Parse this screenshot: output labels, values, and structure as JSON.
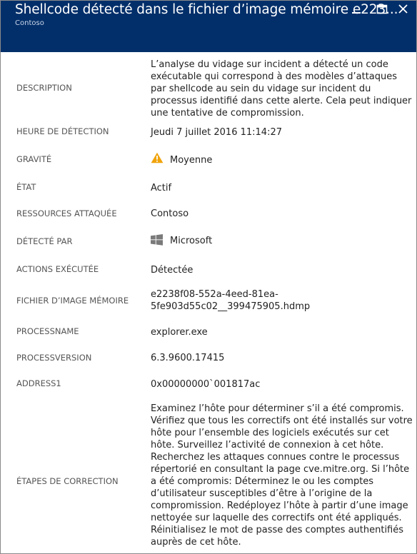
{
  "window": {
    "title": "Shellcode détecté dans le fichier d’image mémoire e223...",
    "subtitle": "Contoso",
    "controls": {
      "minimize": "minimize",
      "maximize": "maximize",
      "close": "close"
    }
  },
  "fields": {
    "description": {
      "label": "DESCRIPTION",
      "value": "L’analyse du vidage sur incident a détecté un code exécutable qui correspond à des modèles d’attaques par shellcode au sein du vidage sur incident du processus identifié dans cette alerte. Cela peut indiquer une tentative de compromission."
    },
    "detection_time": {
      "label": "HEURE DE DÉTECTION",
      "value": "Jeudi 7 juillet 2016 11:14:27"
    },
    "severity": {
      "label": "GRAVITÉ",
      "value": "Moyenne",
      "icon": "warning-icon",
      "icon_color": "#f0a30a"
    },
    "state": {
      "label": "ÉTAT",
      "value": "Actif"
    },
    "attacked_resources": {
      "label": "RESSOURCES ATTAQUÉE",
      "value": "Contoso"
    },
    "detected_by": {
      "label": "DÉTECTÉ PAR",
      "value": "Microsoft",
      "icon": "windows-logo-icon"
    },
    "actions_taken": {
      "label": "ACTIONS EXÉCUTÉE",
      "value": "Détectée"
    },
    "dump_file": {
      "label": "FICHIER D’IMAGE MÉMOIRE",
      "value_line1": "e2238f08-552a-4eed-81ea-",
      "value_line2": "5fe903d55c02__399475905.hdmp"
    },
    "process_name": {
      "label": "PROCESSNAME",
      "value": "explorer.exe"
    },
    "process_version": {
      "label": "PROCESSVERSION",
      "value": "6.3.9600.17415"
    },
    "address1": {
      "label": "ADDRESS1",
      "value": "0x00000000`001817ac"
    },
    "remediation": {
      "label": "ÉTAPES DE CORRECTION",
      "value": "Examinez l’hôte pour déterminer s’il a été compromis. Vérifiez que tous les correctifs ont été installés sur votre hôte pour l’ensemble des logiciels exécutés sur cet hôte. Surveillez l’activité de connexion à cet hôte. Recherchez les attaques connues contre le processus répertorié en consultant la page cve.mitre.org. Si l’hôte a été compromis: Déterminez le ou les comptes d’utilisateur susceptibles d’être à l’origine de la compromission. Redéployez l’hôte à partir d’une image nettoyée sur laquelle des correctifs ont été appliqués. Réinitialisez le mot de passe des comptes authentifiés auprès de cet hôte."
    }
  },
  "colors": {
    "header_bg": "#022f6a",
    "warning": "#f0a30a",
    "label": "#555555"
  }
}
